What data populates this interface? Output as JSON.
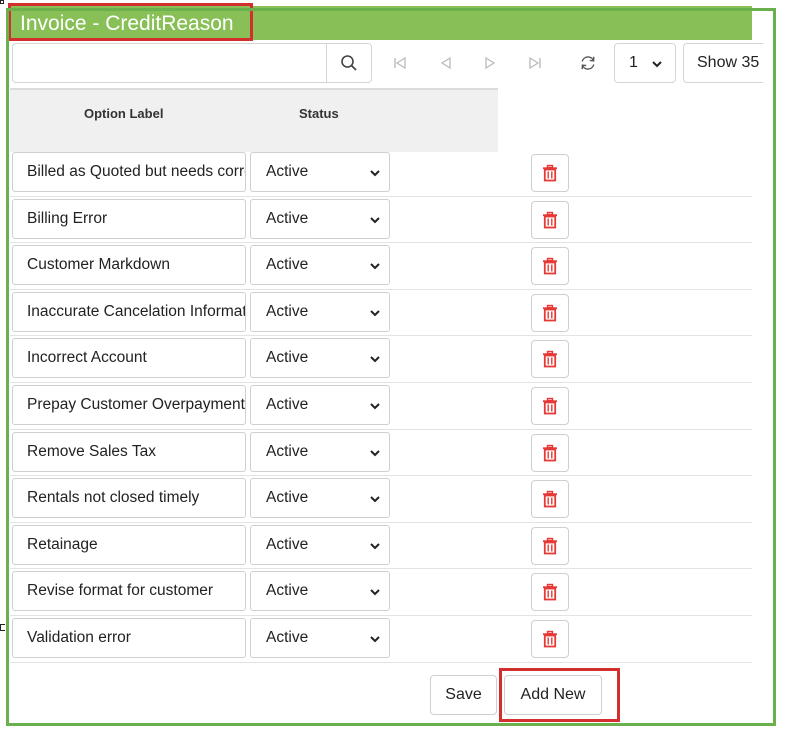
{
  "window": {
    "title": "Invoice - CreditReason"
  },
  "toolbar": {
    "search_value": "",
    "search_placeholder": "",
    "page_value": "1",
    "show_label": "Show 35"
  },
  "table": {
    "columns": [
      "Option Label",
      "Status"
    ],
    "rows": [
      {
        "label": "Billed as Quoted but needs correction",
        "status": "Active"
      },
      {
        "label": "Billing Error",
        "status": "Active"
      },
      {
        "label": "Customer Markdown",
        "status": "Active"
      },
      {
        "label": "Inaccurate Cancelation Information",
        "status": "Active"
      },
      {
        "label": "Incorrect Account",
        "status": "Active"
      },
      {
        "label": "Prepay Customer Overpayment",
        "status": "Active"
      },
      {
        "label": "Remove Sales Tax",
        "status": "Active"
      },
      {
        "label": "Rentals not closed timely",
        "status": "Active"
      },
      {
        "label": "Retainage",
        "status": "Active"
      },
      {
        "label": "Revise format for customer",
        "status": "Active"
      },
      {
        "label": "Validation error",
        "status": "Active"
      }
    ]
  },
  "footer": {
    "save_label": "Save",
    "add_new_label": "Add New"
  },
  "colors": {
    "title_bar": "#88c057",
    "frame": "#6ab04c",
    "highlight": "#d32f2f",
    "delete_icon": "#e53935"
  }
}
